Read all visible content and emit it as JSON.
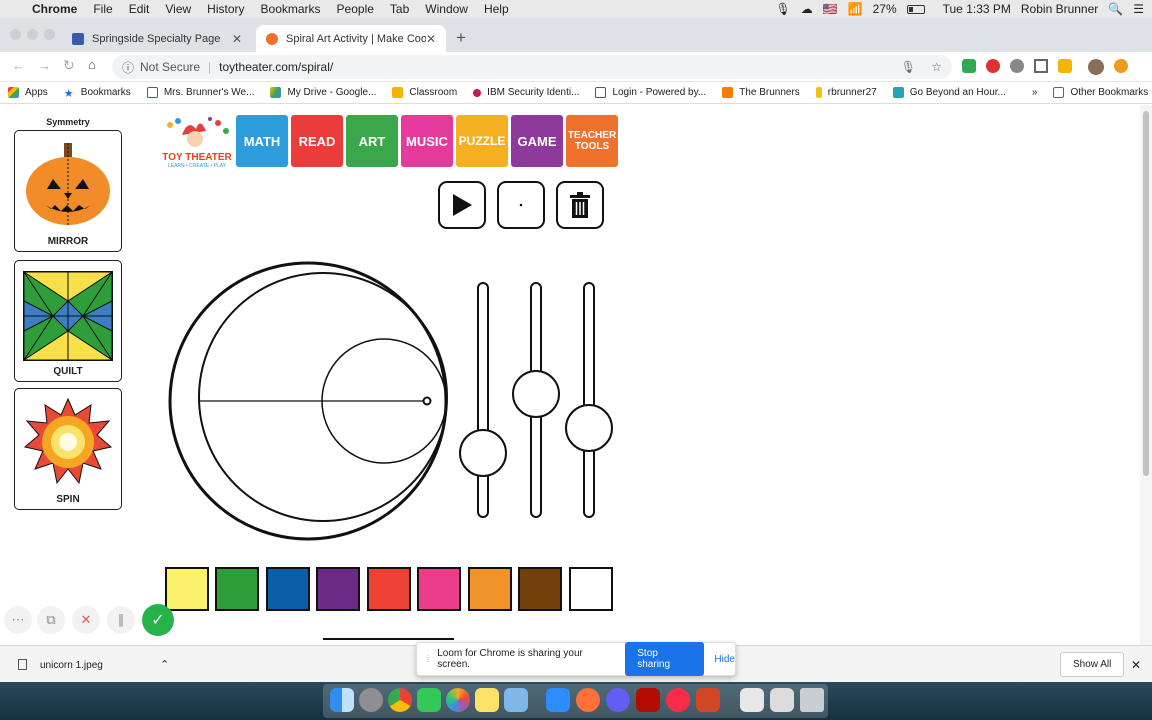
{
  "menubar": {
    "app": "Chrome",
    "items": [
      "File",
      "Edit",
      "View",
      "History",
      "Bookmarks",
      "People",
      "Tab",
      "Window",
      "Help"
    ],
    "battery": "27%",
    "clock": "Tue 1:33 PM",
    "user": "Robin Brunner"
  },
  "tabs": [
    {
      "title": "Springside Specialty Page",
      "active": false
    },
    {
      "title": "Spiral Art Activity | Make Cool Sp",
      "active": true
    }
  ],
  "toolbar": {
    "security": "Not Secure",
    "url": "toytheater.com/spiral/"
  },
  "bookmarks": {
    "items": [
      "Apps",
      "Bookmarks",
      "Mrs. Brunner's We...",
      "My Drive - Google...",
      "Classroom",
      "IBM Security Identi...",
      "Login - Powered by...",
      "The Brunners",
      "rbrunner27",
      "Go Beyond an Hour..."
    ],
    "overflow": "»",
    "other": "Other Bookmarks"
  },
  "sidebar": {
    "heading": "Symmetry",
    "cards": [
      {
        "label": "MIRROR"
      },
      {
        "label": "QUILT"
      },
      {
        "label": "SPIN"
      }
    ]
  },
  "logo": {
    "title": "TOY THEATER",
    "tagline": "LEARN • CREATE • PLAY"
  },
  "nav": [
    {
      "label": "MATH",
      "color": "#2d9cdb"
    },
    {
      "label": "READ",
      "color": "#eb3b3b"
    },
    {
      "label": "ART",
      "color": "#3aa84a"
    },
    {
      "label": "MUSIC",
      "color": "#e33a9c"
    },
    {
      "label": "PUZZLE",
      "color": "#f5b021"
    },
    {
      "label": "GAME",
      "color": "#8e3a9a"
    },
    {
      "label": "TEACHER TOOLS",
      "color": "#f0712c"
    }
  ],
  "controls": {
    "play": "play-icon",
    "dot": "dot-icon",
    "trash": "trash-icon"
  },
  "sliders": [
    0.22,
    0.53,
    0.35
  ],
  "palette": [
    "#f9f26a",
    "#2e9e3a",
    "#0b5fa8",
    "#6a2a85",
    "#ee4136",
    "#ea3d8a",
    "#f0942a",
    "#73400b",
    "#ffffff"
  ],
  "loom": {
    "message": "Loom for Chrome is sharing your screen.",
    "stop": "Stop sharing",
    "hide": "Hide"
  },
  "download": {
    "file": "unicorn 1.jpeg",
    "show_all": "Show All"
  }
}
